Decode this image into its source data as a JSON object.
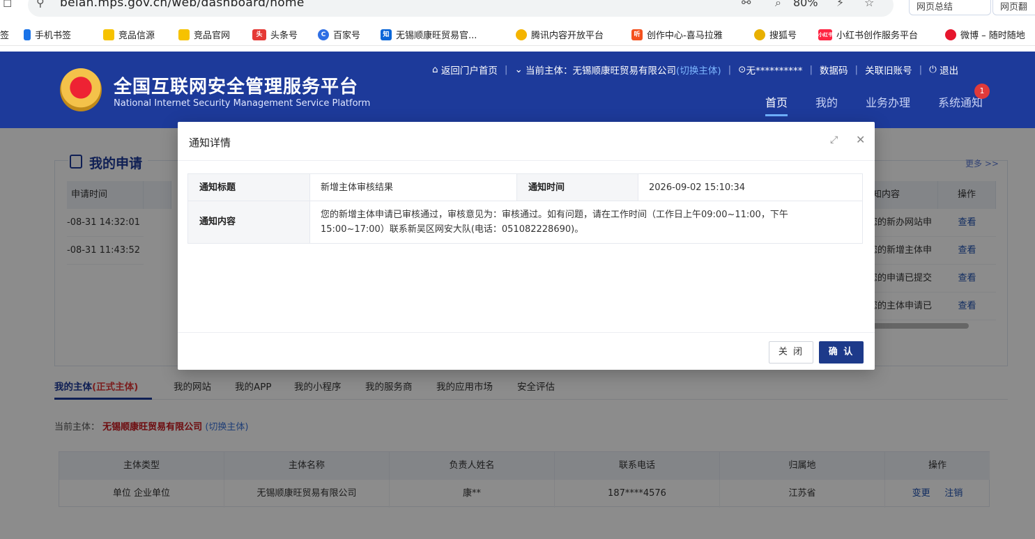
{
  "browser": {
    "url": "beian.mps.gov.cn/web/dashboard/home",
    "zoom": "80%",
    "side_buttons": [
      "网页总结",
      "网页翻"
    ],
    "bookmarks": [
      {
        "label": "签",
        "icon": "bookmark-icon",
        "color": "#ffffff"
      },
      {
        "label": "手机书签",
        "icon": "phone-icon",
        "color": "#1a73e8"
      },
      {
        "label": "竞品信源",
        "icon": "folder-icon",
        "color": "#f6c200"
      },
      {
        "label": "竞品官网",
        "icon": "folder-icon",
        "color": "#f6c200"
      },
      {
        "label": "头条号",
        "icon": "toutiao-icon",
        "color": "#e53935"
      },
      {
        "label": "百家号",
        "icon": "baijia-icon",
        "color": "#2f6fe4"
      },
      {
        "label": "无锡顺康旺贸易官...",
        "icon": "zhihu-icon",
        "color": "#0a66d8"
      },
      {
        "label": "腾讯内容开放平台",
        "icon": "bell-icon",
        "color": "#f4b400"
      },
      {
        "label": "创作中心-喜马拉雅",
        "icon": "ximalaya-icon",
        "color": "#f4511e"
      },
      {
        "label": "搜狐号",
        "icon": "sohu-icon",
        "color": "#e8b000"
      },
      {
        "label": "小红书创作服务平台",
        "icon": "xiaohongshu-icon",
        "color": "#ff2442"
      },
      {
        "label": "微博 – 随时随地",
        "icon": "weibo-icon",
        "color": "#e6162d"
      }
    ]
  },
  "header": {
    "title_cn": "全国互联网安全管理服务平台",
    "title_en": "National Internet Security Management Service Platform",
    "back_portal": "返回门户首页",
    "current_subject_label": "当前主体：无锡顺康旺贸易有限公司",
    "switch_subject": "(切换主体)",
    "user": "无**********",
    "data_code": "数据码",
    "link_old": "关联旧账号",
    "logout": "退出",
    "nav": [
      "首页",
      "我的",
      "业务办理",
      "系统通知"
    ],
    "notify_count": "1"
  },
  "applications": {
    "title": "我的申请",
    "more": "更多 >>",
    "col_time": "申请时间",
    "col_content": "知内容",
    "col_action": "操作",
    "rows": [
      {
        "time": "-08-31 14:32:01",
        "content": "您的新办网站申",
        "action": "查看"
      },
      {
        "time": "-08-31 11:43:52",
        "content": "您的新增主体申",
        "action": "查看"
      },
      {
        "time": "",
        "content": "您的申请已提交",
        "action": "查看"
      },
      {
        "time": "",
        "content": "您的主体申请已",
        "action": "查看"
      }
    ]
  },
  "subject_tabs": [
    "我的主体",
    "(正式主体)",
    "我的网站",
    "我的APP",
    "我的小程序",
    "我的服务商",
    "我的应用市场",
    "安全评估"
  ],
  "current_subject": {
    "label": "当前主体：",
    "name": "无锡顺康旺贸易有限公司",
    "switch": "(切换主体)"
  },
  "entity_table": {
    "headers": [
      "主体类型",
      "主体名称",
      "负责人姓名",
      "联系电话",
      "归属地",
      "操作"
    ],
    "row": [
      "单位  企业单位",
      "无锡顺康旺贸易有限公司",
      "康**",
      "187****4576",
      "江苏省"
    ],
    "actions": [
      "变更",
      "注销"
    ]
  },
  "modal": {
    "title": "通知详情",
    "label_title": "通知标题",
    "value_title": "新增主体审核结果",
    "label_time": "通知时间",
    "value_time": "2026-09-02 15:10:34",
    "label_content": "通知内容",
    "value_content": "您的新增主体申请已审核通过，审核意见为：审核通过。如有问题，请在工作时间（工作日上午09:00~11:00，下午15:00~17:00）联系新吴区网安大队(电话：051082228690)。",
    "close_btn": "关 闭",
    "ok_btn": "确 认"
  }
}
